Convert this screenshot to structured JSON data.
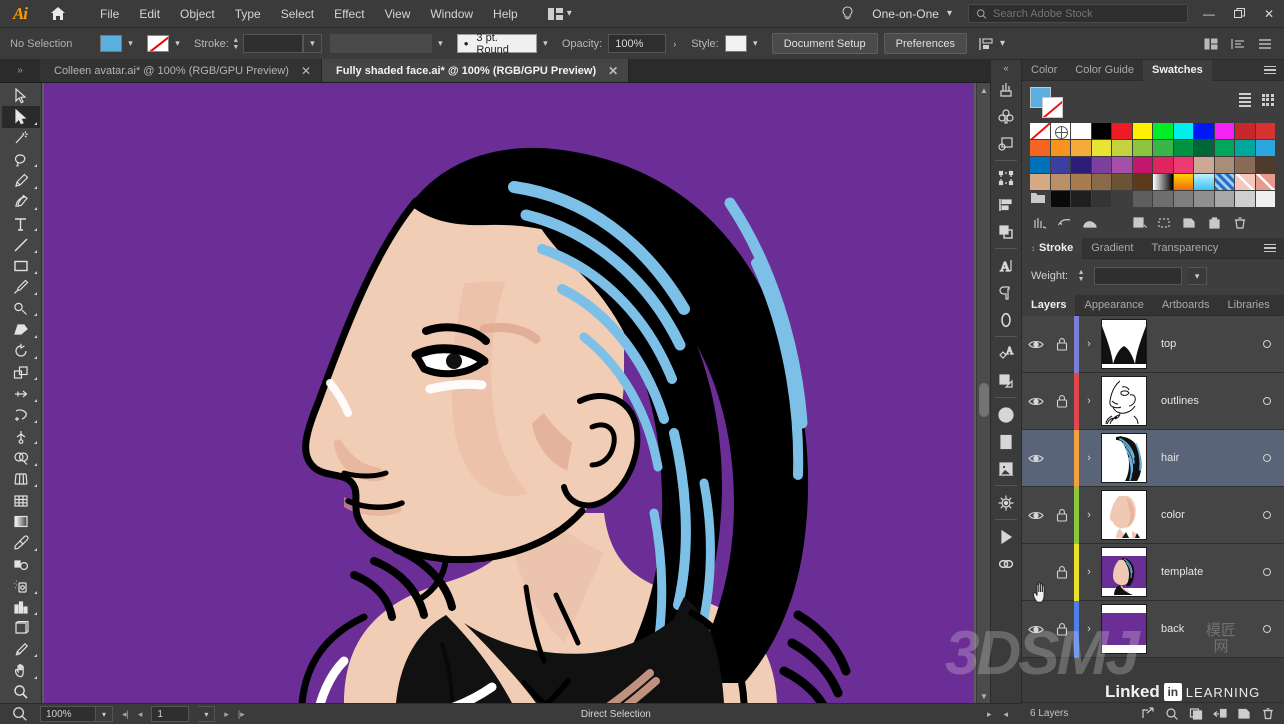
{
  "app": {
    "name": "Adobe Illustrator",
    "logo": "Ai"
  },
  "menubar": {
    "items": [
      "File",
      "Edit",
      "Object",
      "Type",
      "Select",
      "Effect",
      "View",
      "Window",
      "Help"
    ],
    "workspace": "One-on-One",
    "search_placeholder": "Search Adobe Stock",
    "icons": {
      "home": "home-icon",
      "bulb": "lightbulb-icon",
      "arrange": "arrange-documents-icon",
      "search": "search-icon"
    },
    "window_controls": {
      "minimize": "—",
      "restore": "❐",
      "close": "✕"
    }
  },
  "controlbar": {
    "selection_status": "No Selection",
    "fill_color": "#5bafe0",
    "stroke_label": "Stroke:",
    "stroke_weight": "",
    "profile": "",
    "brush": "3 pt. Round",
    "opacity_label": "Opacity:",
    "opacity_value": "100%",
    "style_label": "Style:",
    "document_setup": "Document Setup",
    "preferences": "Preferences"
  },
  "tabs": [
    {
      "title": "Colleen avatar.ai* @ 100% (RGB/GPU Preview)",
      "active": false,
      "close": "✕"
    },
    {
      "title": "Fully shaded face.ai* @ 100% (RGB/GPU Preview)",
      "active": true,
      "close": "✕"
    }
  ],
  "toolbar": {
    "tools": [
      {
        "name": "selection-tool",
        "active": false
      },
      {
        "name": "direct-selection-tool",
        "active": true
      },
      {
        "name": "magic-wand-tool",
        "active": false
      },
      {
        "name": "lasso-tool",
        "active": false
      },
      {
        "name": "pen-tool",
        "active": false
      },
      {
        "name": "curvature-tool",
        "active": false
      },
      {
        "name": "type-tool",
        "active": false
      },
      {
        "name": "line-segment-tool",
        "active": false
      },
      {
        "name": "rectangle-tool",
        "active": false
      },
      {
        "name": "paintbrush-tool",
        "active": false
      },
      {
        "name": "shaper-tool",
        "active": false
      },
      {
        "name": "eraser-tool",
        "active": false
      },
      {
        "name": "rotate-tool",
        "active": false
      },
      {
        "name": "scale-tool",
        "active": false
      },
      {
        "name": "width-tool",
        "active": false
      },
      {
        "name": "free-transform-tool",
        "active": false
      },
      {
        "name": "puppet-warp-tool",
        "active": false
      },
      {
        "name": "shape-builder-tool",
        "active": false
      },
      {
        "name": "perspective-grid-tool",
        "active": false
      },
      {
        "name": "mesh-tool",
        "active": false
      },
      {
        "name": "gradient-tool",
        "active": false
      },
      {
        "name": "eyedropper-tool",
        "active": false
      },
      {
        "name": "blend-tool",
        "active": false
      },
      {
        "name": "symbol-sprayer-tool",
        "active": false
      },
      {
        "name": "column-graph-tool",
        "active": false
      },
      {
        "name": "artboard-tool",
        "active": false
      },
      {
        "name": "slice-tool",
        "active": false
      },
      {
        "name": "hand-tool",
        "active": false
      },
      {
        "name": "zoom-tool",
        "active": false
      }
    ]
  },
  "icondock": {
    "icons": [
      "brushes-icon",
      "symbols-icon",
      "graphic-styles-icon",
      "transform-icon",
      "align-icon",
      "pathfinder-icon",
      "character-icon",
      "paragraph-icon",
      "opentype-icon",
      "document-info-icon",
      "attributes-icon",
      "info-icon",
      "separations-preview-icon",
      "links-icon",
      "magic-wand-panel-icon",
      "actions-icon",
      "asset-export-icon"
    ],
    "collapse": "«"
  },
  "panels": {
    "color_group": {
      "tabs": [
        {
          "label": "Color",
          "active": false
        },
        {
          "label": "Color Guide",
          "active": false
        },
        {
          "label": "Swatches",
          "active": true
        }
      ]
    },
    "swatches": {
      "fill_color": "#5bafe0",
      "stroke_color": "none",
      "rows": [
        [
          "none",
          "registration",
          "#ffffff",
          "#000000",
          "#ed1c24",
          "#fff200",
          "#00ee2a",
          "#00eeee",
          "#0019f4",
          "#f423f4",
          "#c6282c",
          "#d63330"
        ],
        [
          "#f26522",
          "#f7941e",
          "#f5aa3c",
          "#e8e435",
          "#c4d23f",
          "#8cc63e",
          "#39b54a",
          "#009344",
          "#006838",
          "#00a65a",
          "#00a79d",
          "#2ba7df"
        ],
        [
          "#0072bc",
          "#3b3fa0",
          "#2b1d78",
          "#7b3f9e",
          "#a64fa8",
          "#c2166f",
          "#e0245e",
          "#ee3a72",
          "#cda894",
          "#a98d78",
          "#8a6b55",
          "#4f3b2d"
        ],
        [
          "#d4ab84",
          "#bb9066",
          "#a87c4f",
          "#8a6a4a",
          "#6b5436",
          "#5d3a1a",
          "gradient-white-black",
          "gradient-orange",
          "gradient-cyan",
          "pattern-blue",
          "gradient-pink",
          "gradient-salmon"
        ],
        [
          "folder",
          "#0a0a0a",
          "#1f1f1f",
          "#343434",
          "",
          "#5e5e5e",
          "#6e6e6e",
          "#7e7e7e",
          "#8f8f8f",
          "#a8a8a8",
          "#cfcfcf",
          "#efefef"
        ]
      ],
      "view_list_icon": "list-view-icon",
      "view_grid_icon": "grid-view-icon",
      "footer_icons": [
        "swatch-libraries-icon",
        "show-swatch-kinds-icon",
        "color-group-icon",
        "swatch-options-icon",
        "new-color-group-icon",
        "new-swatch-icon",
        "delete-swatch-icon"
      ]
    },
    "stroke_group": {
      "tabs": [
        {
          "label": "Stroke",
          "active": true
        },
        {
          "label": "Gradient",
          "active": false
        },
        {
          "label": "Transparency",
          "active": false
        }
      ],
      "weight_label": "Weight:",
      "weight_value": ""
    },
    "layers_group": {
      "tabs": [
        {
          "label": "Layers",
          "active": true
        },
        {
          "label": "Appearance",
          "active": false
        },
        {
          "label": "Artboards",
          "active": false
        },
        {
          "label": "Libraries",
          "active": false
        }
      ],
      "layers": [
        {
          "name": "top",
          "color": "#7b7fd6",
          "visible": true,
          "locked": true,
          "selected": false,
          "thumb": "top-thumb"
        },
        {
          "name": "outlines",
          "color": "#e0474c",
          "visible": true,
          "locked": true,
          "selected": false,
          "thumb": "outlines-thumb"
        },
        {
          "name": "hair",
          "color": "#f0a33c",
          "visible": true,
          "locked": false,
          "selected": true,
          "thumb": "hair-thumb"
        },
        {
          "name": "color",
          "color": "#8dc63f",
          "visible": true,
          "locked": true,
          "selected": false,
          "thumb": "color-thumb"
        },
        {
          "name": "template",
          "color": "#e8e32a",
          "visible": false,
          "locked": true,
          "selected": false,
          "thumb": "template-thumb"
        },
        {
          "name": "back",
          "color": "#4d7fe8",
          "visible": true,
          "locked": true,
          "selected": false,
          "thumb": "back-thumb"
        }
      ],
      "footer_count": "6 Layers",
      "footer_icons": [
        "release-to-layers-icon",
        "locate-object-icon",
        "make-clipping-mask-icon",
        "create-new-sublayer-icon",
        "create-new-layer-icon",
        "delete-selection-icon"
      ]
    }
  },
  "statusbar": {
    "zoom": "100%",
    "artboard_number": "1",
    "current_tool": "Direct Selection",
    "nav_icons": [
      "first-artboard-icon",
      "previous-artboard-icon",
      "next-artboard-icon",
      "last-artboard-icon"
    ]
  },
  "watermark": {
    "site": "3DSMJ",
    "cjk": "模匠网",
    "brand": "Linked",
    "brand_box": "in",
    "brand_sub": "LEARNING"
  },
  "artwork": {
    "background": "#6b2d96",
    "skin": "#f2cdb5",
    "skin_shadow": "#e0a893",
    "hair": "#000000",
    "hair_highlight": "#7cc0e8",
    "top": "#111111",
    "outline": "#000000",
    "highlight": "#ffffff"
  }
}
